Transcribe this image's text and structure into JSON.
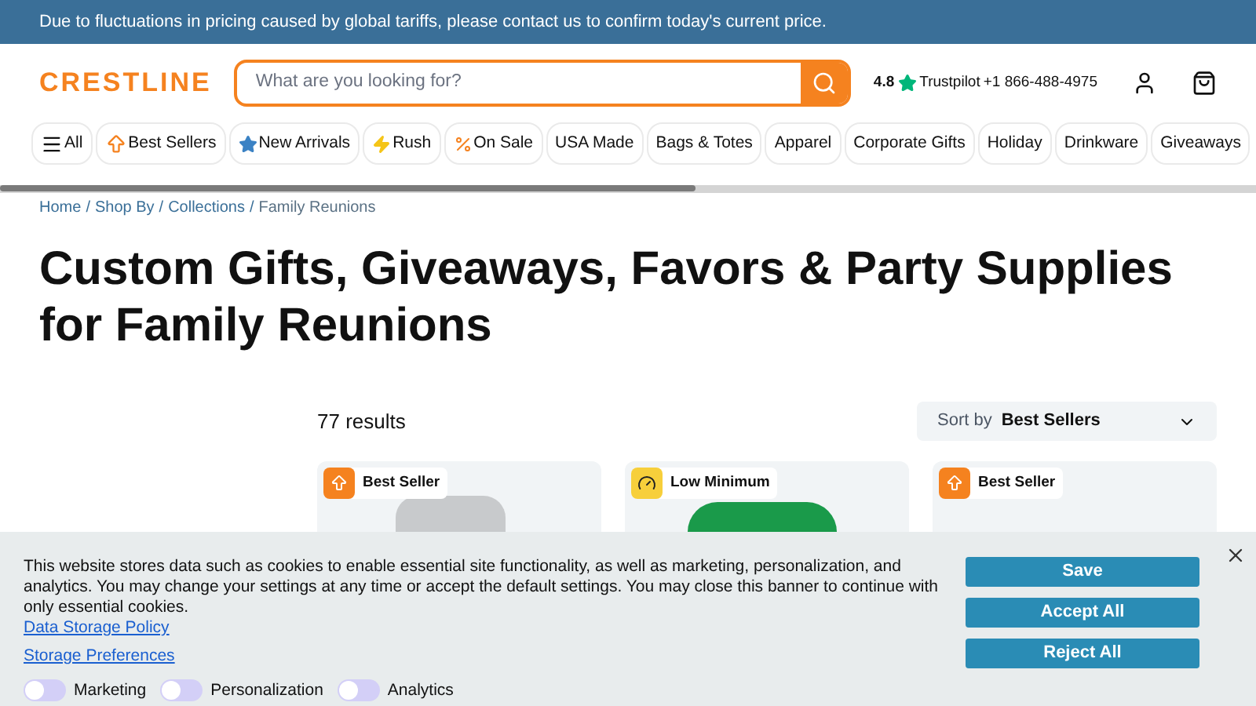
{
  "announcement": "Due to fluctuations in pricing caused by global tariffs, please contact us to confirm today's current price.",
  "header": {
    "logo": "CRESTLINE",
    "search": {
      "placeholder": "What are you looking for?"
    },
    "rating": "4.8",
    "trustpilot": "Trustpilot",
    "phone": "+1 866-488-4975"
  },
  "nav": [
    {
      "label": "All",
      "kind": "menu"
    },
    {
      "label": "Best Sellers",
      "kind": "up"
    },
    {
      "label": "New Arrivals",
      "kind": "star"
    },
    {
      "label": "Rush",
      "kind": "rush"
    },
    {
      "label": "On Sale",
      "kind": "percent"
    },
    {
      "label": "USA Made",
      "kind": "plain"
    },
    {
      "label": "Bags & Totes",
      "kind": "plain"
    },
    {
      "label": "Apparel",
      "kind": "plain"
    },
    {
      "label": "Corporate Gifts",
      "kind": "plain"
    },
    {
      "label": "Holiday",
      "kind": "plain"
    },
    {
      "label": "Drinkware",
      "kind": "plain"
    },
    {
      "label": "Giveaways",
      "kind": "plain"
    }
  ],
  "breadcrumb": {
    "separator": "/",
    "items": [
      "Home",
      "Shop By",
      "Collections",
      "Family Reunions"
    ]
  },
  "title": "Custom Gifts, Giveaways, Favors & Party Supplies for Family Reunions",
  "results": "77 results",
  "sort": {
    "label": "Sort by",
    "value": "Best Sellers"
  },
  "products": [
    {
      "badge": "Best Seller",
      "kind": "best"
    },
    {
      "badge": "Low Minimum",
      "kind": "low"
    },
    {
      "badge": "Best Seller",
      "kind": "best"
    }
  ],
  "cookie": {
    "text": "This website stores data such as cookies to enable essential site functionality, as well as marketing, personalization, and analytics. You may change your settings at any time or accept the default settings. You may close this banner to continue with only essential cookies.",
    "policy": "Data Storage Policy",
    "preferences": "Storage Preferences",
    "toggles": [
      {
        "label": "Marketing",
        "on": false
      },
      {
        "label": "Personalization",
        "on": false
      },
      {
        "label": "Analytics",
        "on": false
      }
    ],
    "buttons": [
      "Save",
      "Accept All",
      "Reject All"
    ]
  }
}
